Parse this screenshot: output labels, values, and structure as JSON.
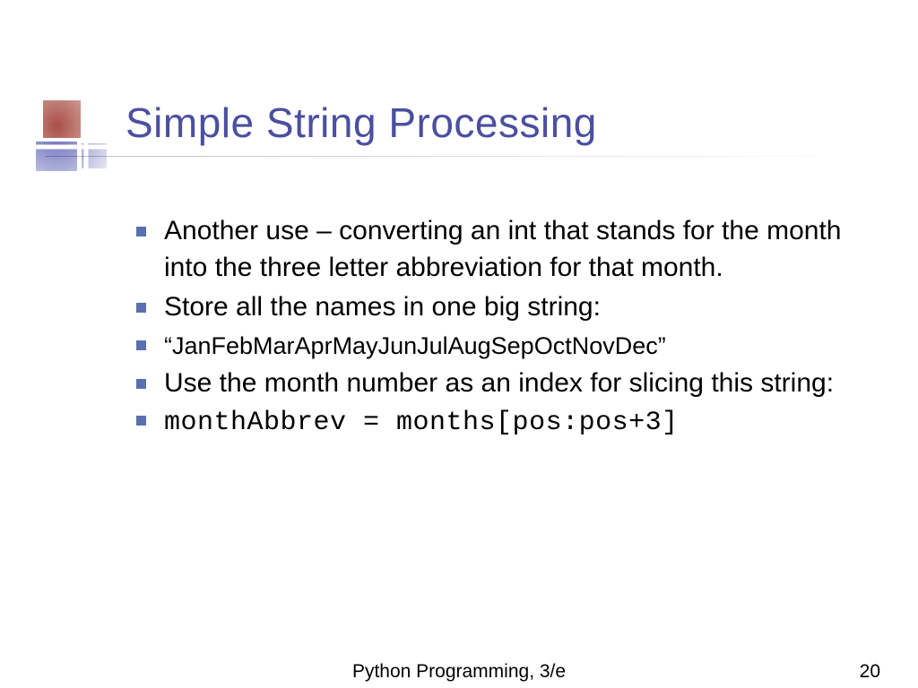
{
  "title": "Simple String Processing",
  "bullets": {
    "b1": "Another use – converting an int that stands for the month into the three letter abbreviation for that month.",
    "b2": "Store all the names in one big string:",
    "b3": "“JanFebMarAprMayJunJulAugSepOctNovDec”",
    "b4": "Use the month number as an index for slicing this string:",
    "b5": "monthAbbrev = months[pos:pos+3]"
  },
  "footer": {
    "text": "Python Programming, 3/e",
    "page": "20"
  }
}
